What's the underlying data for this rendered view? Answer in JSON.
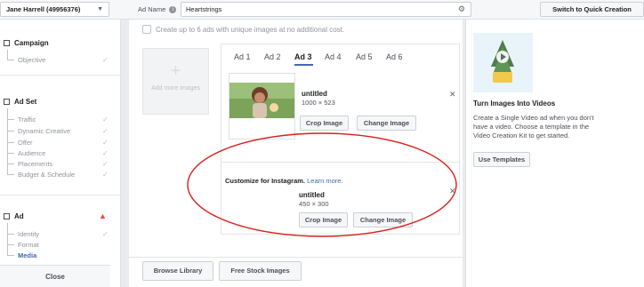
{
  "topbar": {
    "account": "Jane Harrell (49956376)",
    "ad_name_label": "Ad Name",
    "ad_name_value": "Heartstrings",
    "quick_creation_label": "Switch to Quick Creation"
  },
  "sidebar": {
    "campaign": {
      "title": "Campaign",
      "items": [
        "Objective"
      ]
    },
    "adset": {
      "title": "Ad Set",
      "items": [
        "Traffic",
        "Dynamic Creative",
        "Offer",
        "Audience",
        "Placements",
        "Budget & Schedule"
      ]
    },
    "ad": {
      "title": "Ad",
      "items": [
        "Identity",
        "Format",
        "Media"
      ]
    },
    "close_label": "Close"
  },
  "main": {
    "info_text": "Create up to 6 ads with unique images at no additional cost.",
    "add_more_label": "Add more images",
    "tabs": [
      "Ad 1",
      "Ad 2",
      "Ad 3",
      "Ad 4",
      "Ad 5",
      "Ad 6"
    ],
    "active_tab": "Ad 3",
    "card1": {
      "name": "untitled",
      "dims": "1000 × 523",
      "crop_label": "Crop Image",
      "change_label": "Change Image"
    },
    "customize": {
      "title": "Customize for Instagram.",
      "link": "Learn more.",
      "name": "untitled",
      "dims": "450 × 300",
      "crop_label": "Crop Image",
      "change_label": "Change Image"
    },
    "browse_label": "Browse Library",
    "stock_label": "Free Stock Images"
  },
  "right_panel": {
    "title": "Turn Images Into Videos",
    "description": "Create a Single Video ad when you don't have a video. Choose a template in the Video Creation Kit to get started.",
    "button_label": "Use Templates"
  },
  "colors": {
    "accent": "#4267b2",
    "annotation": "#d91e18",
    "warning": "#fa3e3e"
  }
}
